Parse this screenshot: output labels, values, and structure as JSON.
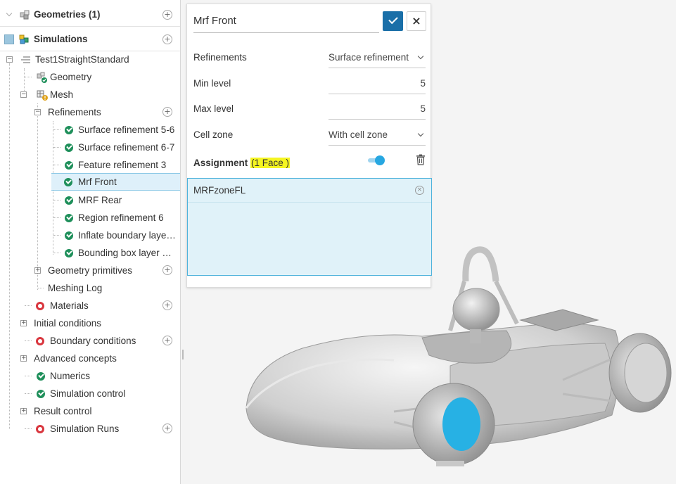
{
  "tree": {
    "geometries": {
      "label": "Geometries (1)"
    },
    "simulations": {
      "label": "Simulations"
    },
    "sim_name": "Test1StraightStandard",
    "geometry": "Geometry",
    "mesh": "Mesh",
    "refinements": "Refinements",
    "refinement_items": [
      "Surface refinement 5-6",
      "Surface refinement 6-7",
      "Feature refinement 3",
      "Mrf Front",
      "MRF Rear",
      "Region refinement 6",
      "Inflate boundary layer...",
      "Bounding box layer ad..."
    ],
    "geometry_primitives": "Geometry primitives",
    "meshing_log": "Meshing Log",
    "materials": "Materials",
    "initial_conditions": "Initial conditions",
    "boundary_conditions": "Boundary conditions",
    "advanced_concepts": "Advanced concepts",
    "numerics": "Numerics",
    "simulation_control": "Simulation control",
    "result_control": "Result control",
    "simulation_runs": "Simulation Runs"
  },
  "dialog": {
    "title": "Mrf Front",
    "fields": {
      "refinements": {
        "label": "Refinements",
        "value": "Surface refinement"
      },
      "min_level": {
        "label": "Min level",
        "value": "5"
      },
      "max_level": {
        "label": "Max level",
        "value": "5"
      },
      "cell_zone": {
        "label": "Cell zone",
        "value": "With cell zone"
      }
    },
    "assignment": {
      "label": "Assignment",
      "count": "(1 Face )"
    },
    "assigned_items": [
      "MRFzoneFL"
    ]
  },
  "colors": {
    "accent": "#1a6fa8",
    "ok": "#1e8f5a",
    "error": "#d9363e",
    "highlight": "#f5f522",
    "selected_face": "#27b1e4"
  }
}
